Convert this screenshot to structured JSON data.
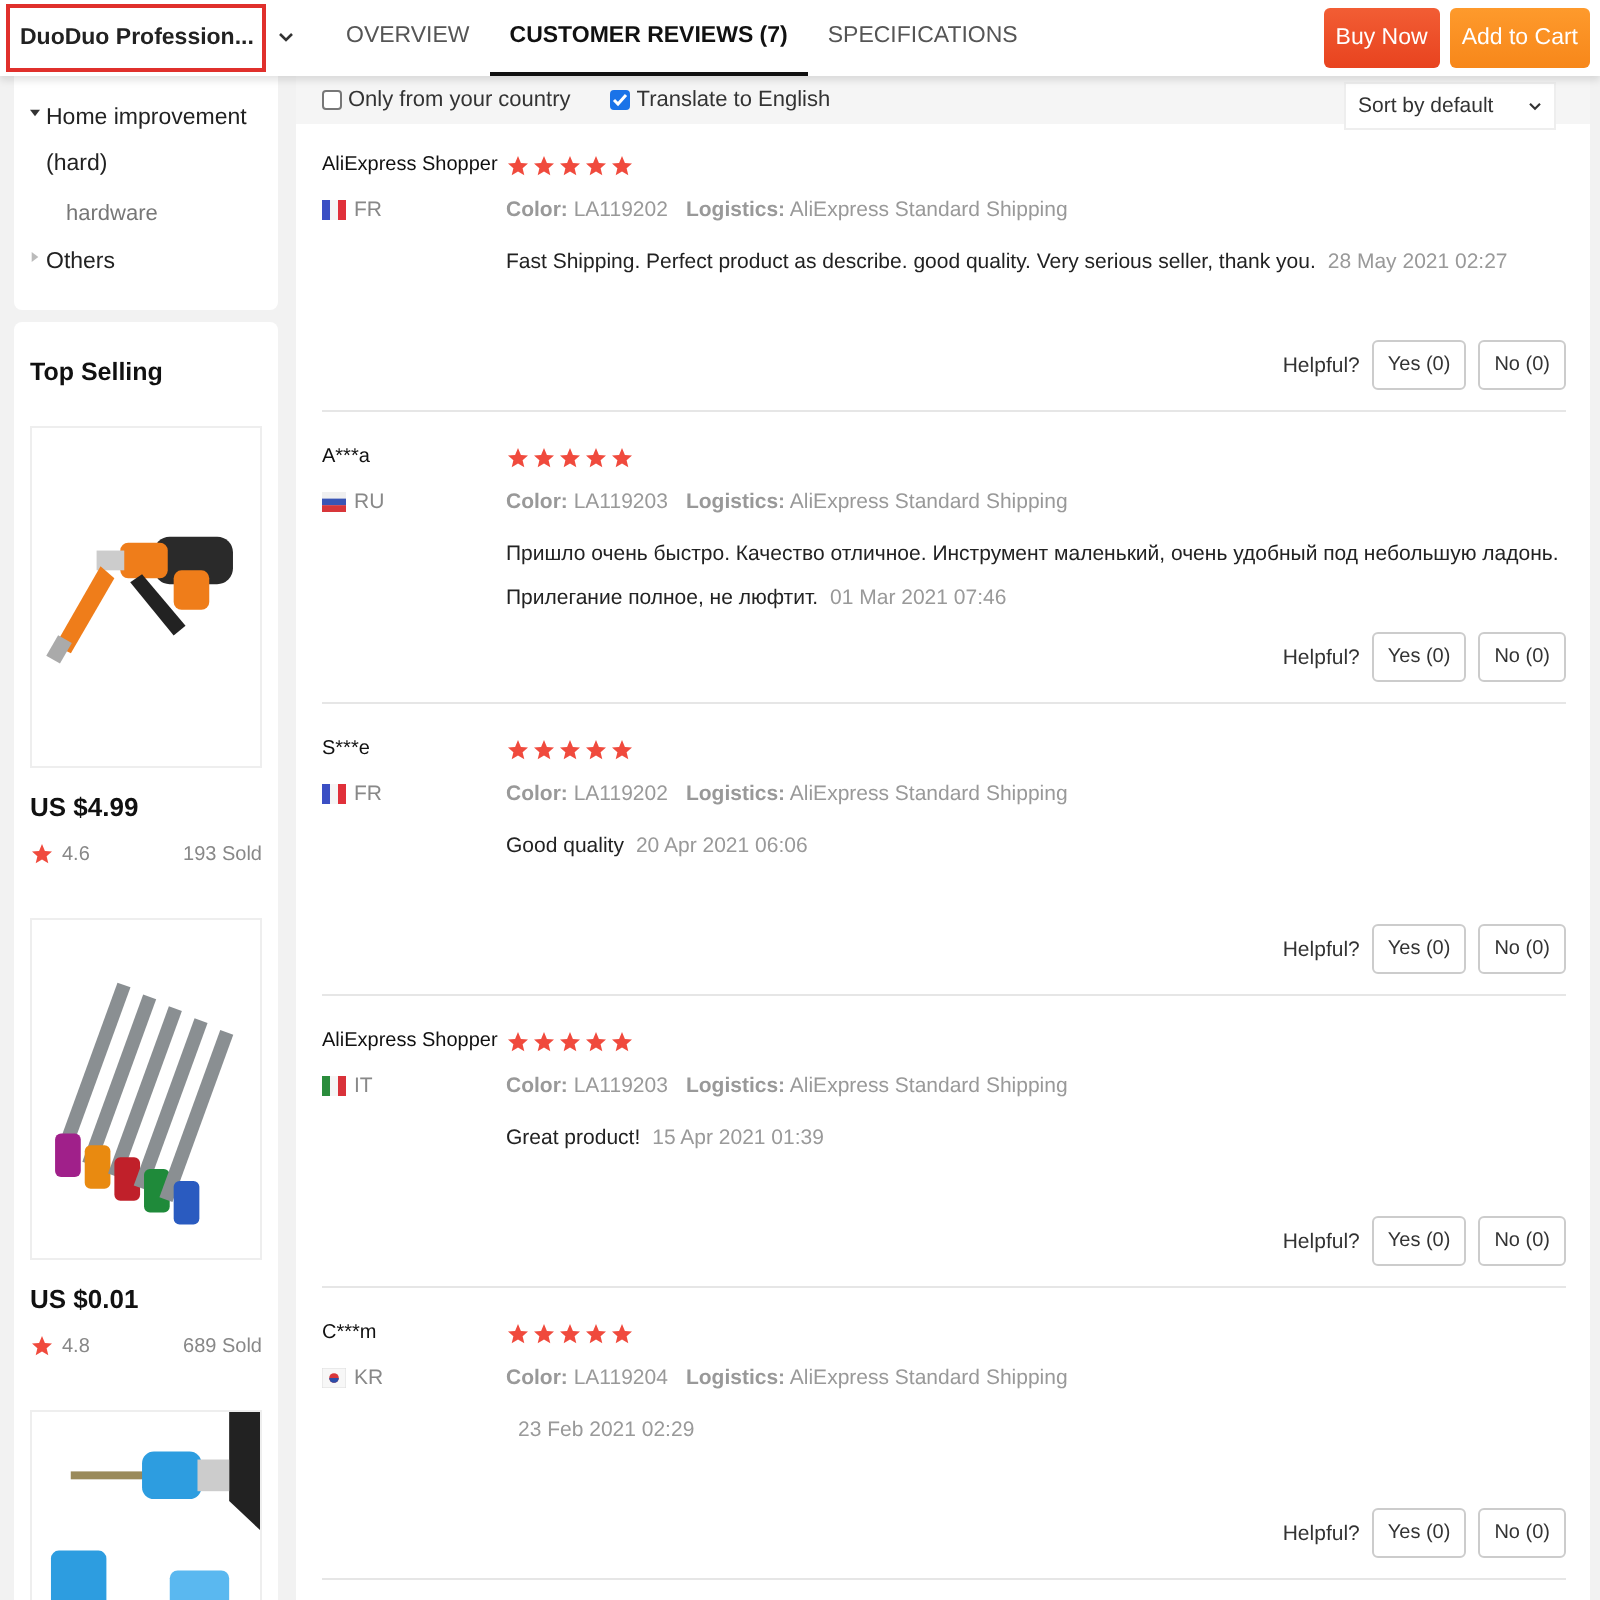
{
  "store_selector": {
    "label": "DuoDuo Profession..."
  },
  "tabs": [
    {
      "label": "OVERVIEW",
      "selected": false
    },
    {
      "label": "CUSTOMER REVIEWS (7)",
      "selected": true
    },
    {
      "label": "SPECIFICATIONS",
      "selected": false
    }
  ],
  "actions": [
    {
      "label": "Buy Now",
      "kind": "buy"
    },
    {
      "label": "Add to Cart",
      "kind": "cart"
    }
  ],
  "categories": [
    {
      "label": "Home improvement (hard)",
      "expanded": true,
      "children": [
        {
          "label": "hardware"
        }
      ]
    },
    {
      "label": "Others",
      "expanded": false
    }
  ],
  "top_selling": {
    "title": "Top Selling",
    "products": [
      {
        "kind": "drill",
        "price": "US $4.99",
        "rating": "4.6",
        "sold": "193 Sold"
      },
      {
        "kind": "bits",
        "price": "US $0.01",
        "rating": "4.8",
        "sold": "689 Sold"
      },
      {
        "kind": "holder"
      }
    ]
  },
  "filters": [
    {
      "label": "Only from your country",
      "checked": false
    },
    {
      "label": "Translate to English",
      "checked": true
    }
  ],
  "sort": {
    "value": "Sort by default"
  },
  "reviews": [
    {
      "name": "AliExpress Shopper",
      "stars": 5,
      "kind": "france",
      "country": "FR",
      "color_label": "Color:",
      "variant": "LA119202",
      "logistics_label": "Logistics:",
      "logistics": "AliExpress Standard Shipping",
      "text": "Fast Shipping. Perfect product as describe. good quality. Very serious seller, thank you.",
      "date": "28 May 2021 02:27",
      "helpful": "Helpful?",
      "yes": "Yes (0)",
      "no": "No (0)"
    },
    {
      "name": "A***a",
      "stars": 5,
      "kind": "russia",
      "country": "RU",
      "color_label": "Color:",
      "variant": "LA119203",
      "logistics_label": "Logistics:",
      "logistics": "AliExpress Standard Shipping",
      "text": "Пришло очень быстро. Качество отличное. Инструмент маленький, очень удобный под небольшую ладонь. Прилегание полное, не люфтит.",
      "date": "01 Mar 2021 07:46",
      "helpful": "Helpful?",
      "yes": "Yes (0)",
      "no": "No (0)"
    },
    {
      "name": "S***e",
      "stars": 5,
      "kind": "france",
      "country": "FR",
      "color_label": "Color:",
      "variant": "LA119202",
      "logistics_label": "Logistics:",
      "logistics": "AliExpress Standard Shipping",
      "text": "Good quality",
      "date": "20 Apr 2021 06:06",
      "helpful": "Helpful?",
      "yes": "Yes (0)",
      "no": "No (0)"
    },
    {
      "name": "AliExpress Shopper",
      "stars": 5,
      "kind": "italy",
      "country": "IT",
      "color_label": "Color:",
      "variant": "LA119203",
      "logistics_label": "Logistics:",
      "logistics": "AliExpress Standard Shipping",
      "text": "Great product!",
      "date": "15 Apr 2021 01:39",
      "helpful": "Helpful?",
      "yes": "Yes (0)",
      "no": "No (0)"
    },
    {
      "name": "C***m",
      "stars": 5,
      "kind": "korea",
      "country": "KR",
      "color_label": "Color:",
      "variant": "LA119204",
      "logistics_label": "Logistics:",
      "logistics": "AliExpress Standard Shipping",
      "date": "23 Feb 2021 02:29",
      "helpful": "Helpful?",
      "yes": "Yes (0)",
      "no": "No (0)"
    }
  ]
}
